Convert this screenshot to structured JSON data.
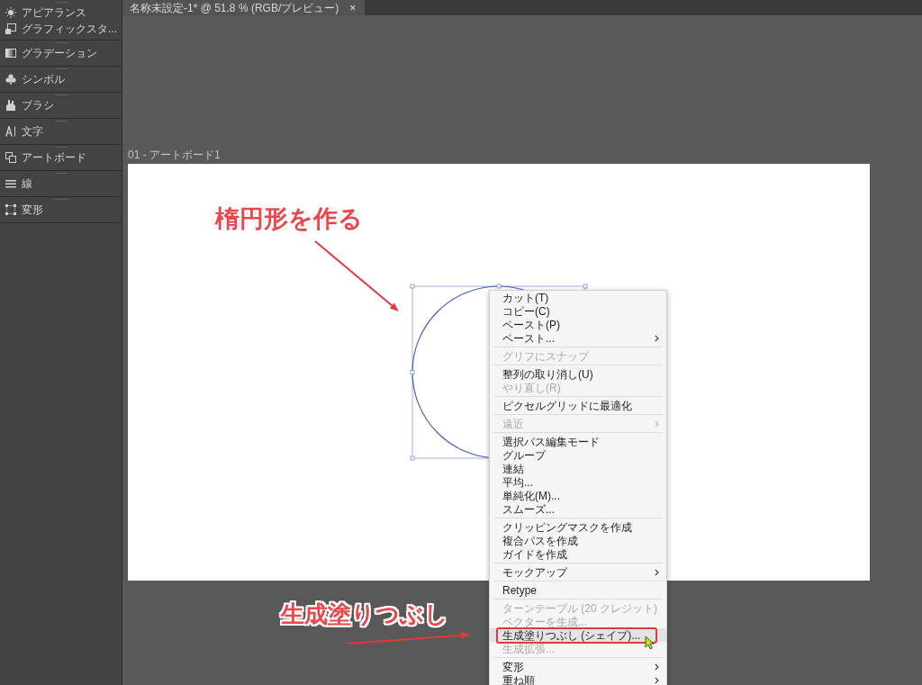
{
  "document_tab": {
    "title": "名称未設定-1* @ 51.8 % (RGB/プレビュー)",
    "close": "×"
  },
  "panels": [
    {
      "items": [
        {
          "label": "アピアランス"
        },
        {
          "label": "グラフィックスタ..."
        }
      ]
    },
    {
      "items": [
        {
          "label": "グラデーション"
        }
      ]
    },
    {
      "items": [
        {
          "label": "シンボル"
        }
      ]
    },
    {
      "items": [
        {
          "label": "ブラシ"
        }
      ]
    },
    {
      "items": [
        {
          "label": "文字"
        }
      ]
    },
    {
      "items": [
        {
          "label": "アートボード"
        }
      ]
    },
    {
      "items": [
        {
          "label": "線"
        }
      ]
    },
    {
      "items": [
        {
          "label": "変形"
        }
      ]
    }
  ],
  "artboard": {
    "label": "01 - アートボード1"
  },
  "annotations": [
    {
      "text": "楕円形を作る"
    },
    {
      "text": "生成塗りつぶし"
    }
  ],
  "context_menu": {
    "items": [
      {
        "kind": "command",
        "label": "カット(T)",
        "disabled": false,
        "submenu": false,
        "selected": false,
        "framed": false
      },
      {
        "kind": "command",
        "label": "コピー(C)",
        "disabled": false,
        "submenu": false,
        "selected": false,
        "framed": false
      },
      {
        "kind": "command",
        "label": "ペースト(P)",
        "disabled": false,
        "submenu": false,
        "selected": false,
        "framed": false
      },
      {
        "kind": "command",
        "label": "ペースト...",
        "disabled": false,
        "submenu": true,
        "selected": false,
        "framed": false
      },
      {
        "kind": "separator"
      },
      {
        "kind": "command",
        "label": "グリフにスナップ",
        "disabled": true,
        "submenu": false,
        "selected": false,
        "framed": false
      },
      {
        "kind": "separator"
      },
      {
        "kind": "command",
        "label": "整列の取り消し(U)",
        "disabled": false,
        "submenu": false,
        "selected": false,
        "framed": false
      },
      {
        "kind": "command",
        "label": "やり直し(R)",
        "disabled": true,
        "submenu": false,
        "selected": false,
        "framed": false
      },
      {
        "kind": "separator"
      },
      {
        "kind": "command",
        "label": "ピクセルグリッドに最適化",
        "disabled": false,
        "submenu": false,
        "selected": false,
        "framed": false
      },
      {
        "kind": "separator"
      },
      {
        "kind": "command",
        "label": "遠近",
        "disabled": true,
        "submenu": true,
        "selected": false,
        "framed": false
      },
      {
        "kind": "separator"
      },
      {
        "kind": "command",
        "label": "選択パス編集モード",
        "disabled": false,
        "submenu": false,
        "selected": false,
        "framed": false
      },
      {
        "kind": "command",
        "label": "グループ",
        "disabled": false,
        "submenu": false,
        "selected": false,
        "framed": false
      },
      {
        "kind": "command",
        "label": "連結",
        "disabled": false,
        "submenu": false,
        "selected": false,
        "framed": false
      },
      {
        "kind": "command",
        "label": "平均...",
        "disabled": false,
        "submenu": false,
        "selected": false,
        "framed": false
      },
      {
        "kind": "command",
        "label": "単純化(M)...",
        "disabled": false,
        "submenu": false,
        "selected": false,
        "framed": false
      },
      {
        "kind": "command",
        "label": "スムーズ...",
        "disabled": false,
        "submenu": false,
        "selected": false,
        "framed": false
      },
      {
        "kind": "separator"
      },
      {
        "kind": "command",
        "label": "クリッピングマスクを作成",
        "disabled": false,
        "submenu": false,
        "selected": false,
        "framed": false
      },
      {
        "kind": "command",
        "label": "複合パスを作成",
        "disabled": false,
        "submenu": false,
        "selected": false,
        "framed": false
      },
      {
        "kind": "command",
        "label": "ガイドを作成",
        "disabled": false,
        "submenu": false,
        "selected": false,
        "framed": false
      },
      {
        "kind": "separator"
      },
      {
        "kind": "command",
        "label": "モックアップ",
        "disabled": false,
        "submenu": true,
        "selected": false,
        "framed": false
      },
      {
        "kind": "separator"
      },
      {
        "kind": "command",
        "label": "Retype",
        "disabled": false,
        "submenu": false,
        "selected": false,
        "framed": false
      },
      {
        "kind": "separator"
      },
      {
        "kind": "command",
        "label": "ターンテーブル (20 クレジット)",
        "disabled": true,
        "submenu": false,
        "selected": false,
        "framed": false
      },
      {
        "kind": "command",
        "label": "ベクターを生成...",
        "disabled": true,
        "submenu": false,
        "selected": false,
        "framed": false
      },
      {
        "kind": "command",
        "label": "生成塗りつぶし (シェイプ)...",
        "disabled": false,
        "submenu": false,
        "selected": true,
        "framed": true
      },
      {
        "kind": "command",
        "label": "生成拡張...",
        "disabled": true,
        "submenu": false,
        "selected": false,
        "framed": false
      },
      {
        "kind": "separator"
      },
      {
        "kind": "command",
        "label": "変形",
        "disabled": false,
        "submenu": true,
        "selected": false,
        "framed": false
      },
      {
        "kind": "command",
        "label": "重ね順",
        "disabled": false,
        "submenu": true,
        "selected": false,
        "framed": false
      }
    ]
  }
}
